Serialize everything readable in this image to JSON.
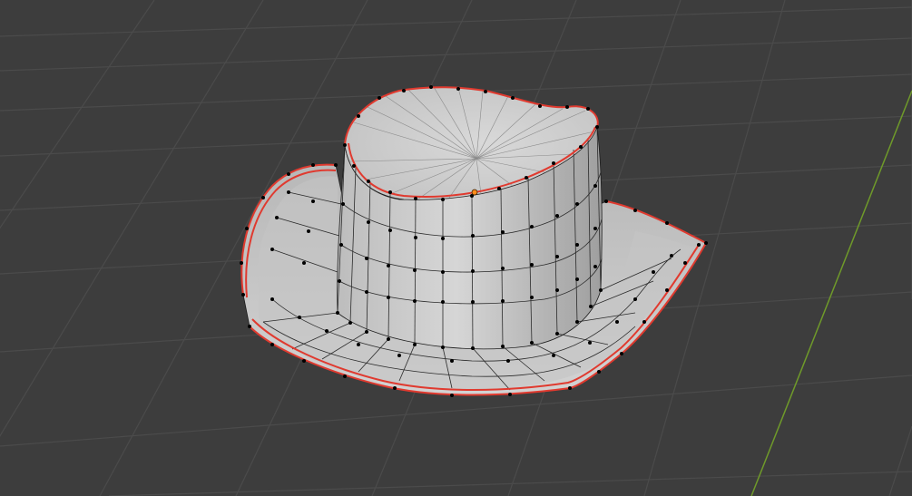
{
  "viewport": {
    "mode": "edit-mode",
    "background_color": "#3d3d3d",
    "grid_color": "#4b4b4b",
    "axis_y_color": "#6f9a2a"
  },
  "mesh": {
    "object": "hat",
    "surface_color": "#c9c9c9",
    "surface_shade_color": "#a9a9a9",
    "wire_color": "#1e1e1e",
    "vertex_color": "#000000",
    "seam_color": "#e03a2f",
    "origin_color": "#ff8c1a"
  }
}
